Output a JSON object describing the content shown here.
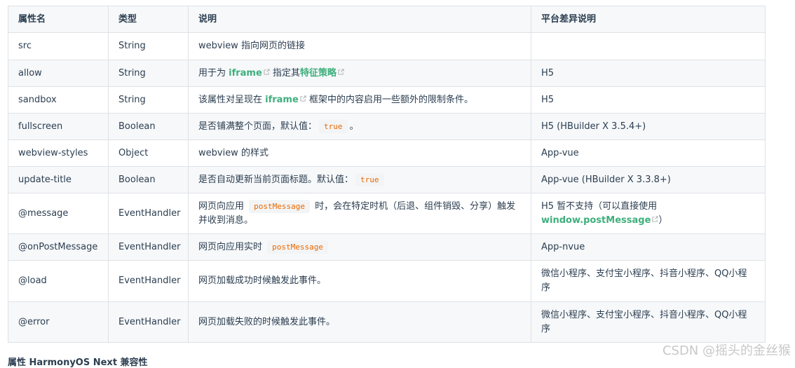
{
  "table": {
    "headers": [
      "属性名",
      "类型",
      "说明",
      "平台差异说明"
    ],
    "rows": [
      {
        "name": "src",
        "type": "String",
        "desc": "webview 指向网页的链接",
        "platform": ""
      },
      {
        "name": "allow",
        "type": "String",
        "desc_parts": {
          "pre": "用于为 ",
          "link1": "iframe",
          "mid": " 指定其",
          "link2": "特征策略"
        },
        "platform": "H5"
      },
      {
        "name": "sandbox",
        "type": "String",
        "desc_parts": {
          "pre": "该属性对呈现在 ",
          "link1": "iframe",
          "post": " 框架中的内容启用一些额外的限制条件。"
        },
        "platform": "H5"
      },
      {
        "name": "fullscreen",
        "type": "Boolean",
        "desc_parts": {
          "pre": "是否铺满整个页面，默认值：",
          "code": "true",
          "post": "。"
        },
        "platform": "H5 (HBuilder X 3.5.4+)"
      },
      {
        "name": "webview-styles",
        "type": "Object",
        "desc": "webview 的样式",
        "platform": "App-vue"
      },
      {
        "name": "update-title",
        "type": "Boolean",
        "desc_parts": {
          "pre": "是否自动更新当前页面标题。默认值：",
          "code": "true"
        },
        "platform": "App-vue (HBuilder X 3.3.8+)"
      },
      {
        "name": "@message",
        "type": "EventHandler",
        "desc_parts": {
          "pre": "网页向应用 ",
          "code": "postMessage",
          "post": " 时，会在特定时机（后退、组件销毁、分享）触发并收到消息。"
        },
        "platform_parts": {
          "pre": "H5 暂不支持（可以直接使用 ",
          "link": "window.postMessage",
          "post": "）"
        }
      },
      {
        "name": "@onPostMessage",
        "type": "EventHandler",
        "desc_parts": {
          "pre": "网页向应用实时 ",
          "code": "postMessage"
        },
        "platform": "App-nvue"
      },
      {
        "name": "@load",
        "type": "EventHandler",
        "desc": "网页加载成功时候触发此事件。",
        "platform": "微信小程序、支付宝小程序、抖音小程序、QQ小程序"
      },
      {
        "name": "@error",
        "type": "EventHandler",
        "desc": "网页加载失败的时候触发此事件。",
        "platform": "微信小程序、支付宝小程序、抖音小程序、QQ小程序"
      }
    ]
  },
  "footer_heading": "属性 HarmonyOS Next 兼容性",
  "watermark": "CSDN @摇头的金丝猴",
  "colors": {
    "link": "#3eaf7c",
    "code": "#e96900",
    "border": "#dfe2e5",
    "stripe": "#f6f8fa"
  },
  "icons": [
    "external-link-icon"
  ]
}
